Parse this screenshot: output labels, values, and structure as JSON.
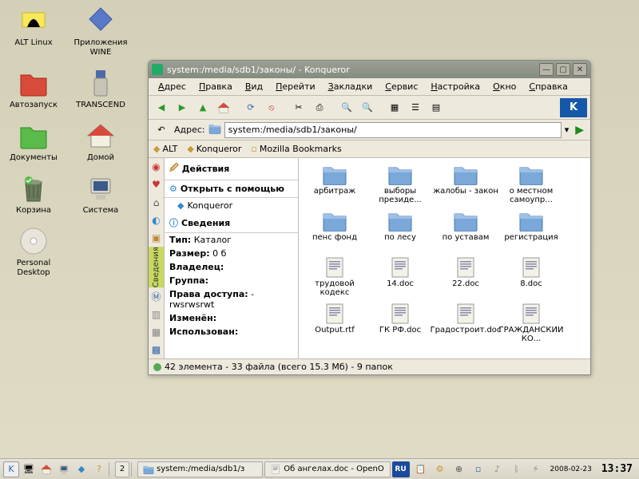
{
  "desktop_icons": [
    {
      "label": "ALT Linux",
      "type": "altlinux"
    },
    {
      "label": "Приложения WINE",
      "type": "wine"
    },
    {
      "label": "Автозапуск",
      "type": "folder-red"
    },
    {
      "label": "TRANSCEND",
      "type": "usb"
    },
    {
      "label": "Документы",
      "type": "folder-green"
    },
    {
      "label": "Домой",
      "type": "home"
    },
    {
      "label": "Корзина",
      "type": "trash"
    },
    {
      "label": "Система",
      "type": "system"
    },
    {
      "label": "Personal Desktop",
      "type": "cd"
    }
  ],
  "window": {
    "title": "system:/media/sdb1/законы/ - Konqueror",
    "menus": [
      "Адрес",
      "Правка",
      "Вид",
      "Перейти",
      "Закладки",
      "Сервис",
      "Настройка",
      "Окно",
      "Справка"
    ],
    "address_label": "Адрес:",
    "address": "system:/media/sdb1/законы/",
    "bookmarks": [
      {
        "label": "ALT",
        "icon": "alt"
      },
      {
        "label": "Konqueror",
        "icon": "konq"
      },
      {
        "label": "Mozilla Bookmarks",
        "icon": "moz"
      }
    ],
    "info": {
      "actions_hdr": "Действия",
      "openwith_hdr": "Открыть с помощью",
      "openwith_item": "Konqueror",
      "details_hdr": "Сведения",
      "rows": [
        {
          "k": "Тип:",
          "v": "Каталог"
        },
        {
          "k": "Размер:",
          "v": "0 б"
        },
        {
          "k": "Владелец:",
          "v": ""
        },
        {
          "k": "Группа:",
          "v": ""
        },
        {
          "k": "Права доступа:",
          "v": "-rwsrwsrwt"
        },
        {
          "k": "Изменён:",
          "v": ""
        },
        {
          "k": "Использован:",
          "v": ""
        }
      ],
      "sidetab_label": "Сведения"
    },
    "files": [
      {
        "name": "арбитраж",
        "t": "folder"
      },
      {
        "name": "выборы президе...",
        "t": "folder"
      },
      {
        "name": "жалобы - закон",
        "t": "folder"
      },
      {
        "name": "о местном самоупр...",
        "t": "folder"
      },
      {
        "name": "пенс фонд",
        "t": "folder"
      },
      {
        "name": "по лесу",
        "t": "folder"
      },
      {
        "name": "по уставам",
        "t": "folder"
      },
      {
        "name": "регистрация",
        "t": "folder"
      },
      {
        "name": "трудовой кодекс",
        "t": "doc"
      },
      {
        "name": "14.doc",
        "t": "doc"
      },
      {
        "name": "22.doc",
        "t": "doc"
      },
      {
        "name": "8.doc",
        "t": "doc"
      },
      {
        "name": "Output.rtf",
        "t": "doc"
      },
      {
        "name": "ГК РФ.doc",
        "t": "doc"
      },
      {
        "name": "Градостроит.doc",
        "t": "doc"
      },
      {
        "name": "ГРАЖДАНСКИЙ КО...",
        "t": "doc"
      }
    ],
    "status": "42 элемента - 33 файла (всего 15.3 Мб) - 9 папок"
  },
  "taskbar": {
    "desk_num": "2",
    "tasks": [
      {
        "label": "system:/media/sdb1/з",
        "icon": "folder"
      },
      {
        "label": "Об ангелах.doc - OpenO",
        "icon": "doc"
      }
    ],
    "lang": "RU",
    "date": "2008-02-23",
    "time": "13:37"
  }
}
